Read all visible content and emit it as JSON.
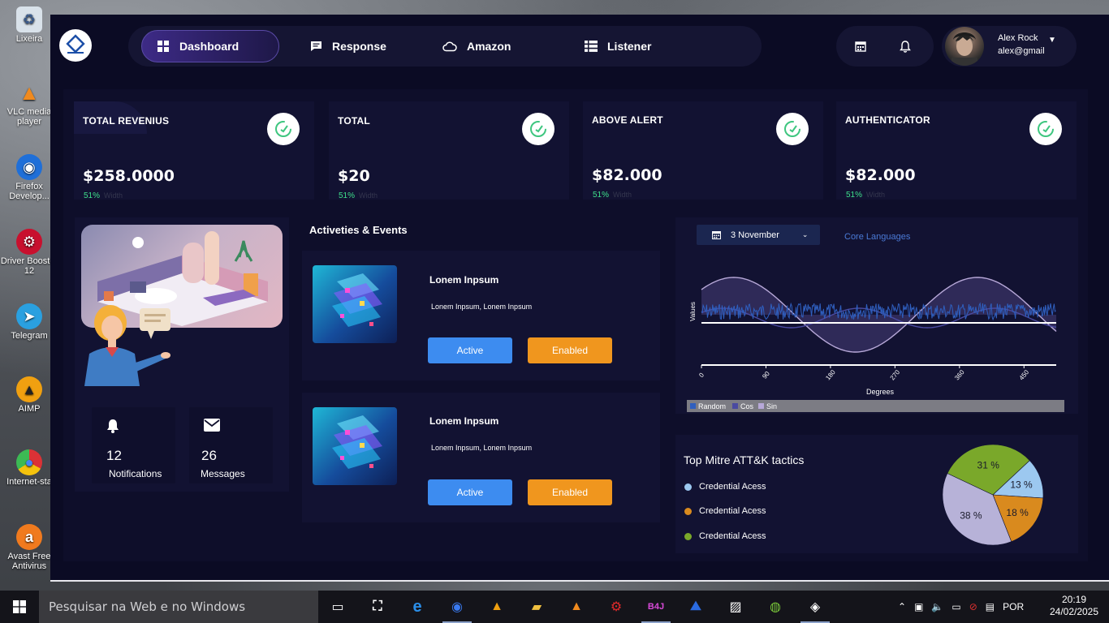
{
  "desktop": {
    "icons": [
      {
        "label": "Lixeira",
        "icon": "recycle-bin-icon"
      },
      {
        "label": "VLC media player",
        "icon": "vlc-icon"
      },
      {
        "label": "Firefox Develop...",
        "icon": "firefox-icon"
      },
      {
        "label": "Driver Booster 12",
        "icon": "driver-booster-icon"
      },
      {
        "label": "Telegram",
        "icon": "telegram-icon"
      },
      {
        "label": "AIMP",
        "icon": "aimp-icon"
      },
      {
        "label": "Internet-sta",
        "icon": "chrome-icon"
      },
      {
        "label": "Avast Free Antivirus",
        "icon": "avast-icon"
      }
    ]
  },
  "nav": {
    "items": [
      {
        "label": "Dashboard",
        "icon": "grid-icon",
        "active": true
      },
      {
        "label": "Response",
        "icon": "chat-icon",
        "active": false
      },
      {
        "label": "Amazon",
        "icon": "cloud-icon",
        "active": false
      },
      {
        "label": "Listener",
        "icon": "list-icon",
        "active": false
      }
    ]
  },
  "user": {
    "name": "Alex Rock",
    "email": "alex@gmail"
  },
  "stats": [
    {
      "title": "TOTAL REVENIUS",
      "value": "$258.0000",
      "percent": "51%",
      "sub": "Width"
    },
    {
      "title": "TOTAL",
      "value": "$20",
      "percent": "51%",
      "sub": "Width"
    },
    {
      "title": "ABOVE ALERT",
      "value": "$82.000",
      "percent": "51%",
      "sub": "Width"
    },
    {
      "title": "AUTHENTICATOR",
      "value": "$82.000",
      "percent": "51%",
      "sub": "Width"
    }
  ],
  "welcome": {
    "notifications_count": "12",
    "notifications_label": "Notifications",
    "messages_count": "26",
    "messages_label": "Messages"
  },
  "activities": {
    "title": "Activeties & Events",
    "events": [
      {
        "title": "Lonem Inpsum",
        "desc": "Lonem Inpsum, Lonem Inpsum",
        "btn_active": "Active",
        "btn_enabled": "Enabled"
      },
      {
        "title": "Lonem Inpsum",
        "desc": "Lonem Inpsum, Lonem Inpsum",
        "btn_active": "Active",
        "btn_enabled": "Enabled"
      }
    ]
  },
  "wave_chart": {
    "date_label": "3 November",
    "core_languages": "Core Languages"
  },
  "colors": {
    "background": "#0b0b24",
    "panel": "#121232",
    "accent_green": "#3ee08b",
    "button_blue": "#3d8cf0",
    "button_orange": "#f0961e",
    "pie_blue": "#9cc8f0",
    "pie_orange": "#d98a1e",
    "pie_green": "#7aa82a",
    "pie_lavender": "#b7b2d8"
  },
  "chart_data": [
    {
      "type": "line",
      "title": "",
      "xlabel": "Degrees",
      "ylabel": "Values",
      "xlim": [
        0,
        495
      ],
      "x_ticks": [
        0,
        90,
        180,
        270,
        360,
        450
      ],
      "ylim": [
        -1.2,
        1.2
      ],
      "legend_position": "bottom",
      "series": [
        {
          "name": "Random",
          "values_desc": "noise",
          "amplitude": 0.15,
          "color": "#2f5fbf"
        },
        {
          "name": "Cos",
          "amplitude": 1.0,
          "color": "#4a4aa0"
        },
        {
          "name": "Sin",
          "amplitude": 1.0,
          "color": "#b7a8d8"
        }
      ]
    },
    {
      "type": "pie",
      "title": "Top Mitre ATT&K tactics",
      "legend": [
        "Credential Acess",
        "Credential Acess",
        "Credential Acess"
      ],
      "slices": [
        {
          "label": "13 %",
          "value": 13,
          "color": "#9cc8f0"
        },
        {
          "label": "18 %",
          "value": 18,
          "color": "#d98a1e"
        },
        {
          "label": "38 %",
          "value": 38,
          "color": "#b7b2d8"
        },
        {
          "label": "31 %",
          "value": 31,
          "color": "#7aa82a"
        }
      ]
    }
  ],
  "taskbar": {
    "search_placeholder": "Pesquisar na Web e no Windows",
    "language": "POR",
    "time": "20:19",
    "date": "24/02/2025"
  }
}
